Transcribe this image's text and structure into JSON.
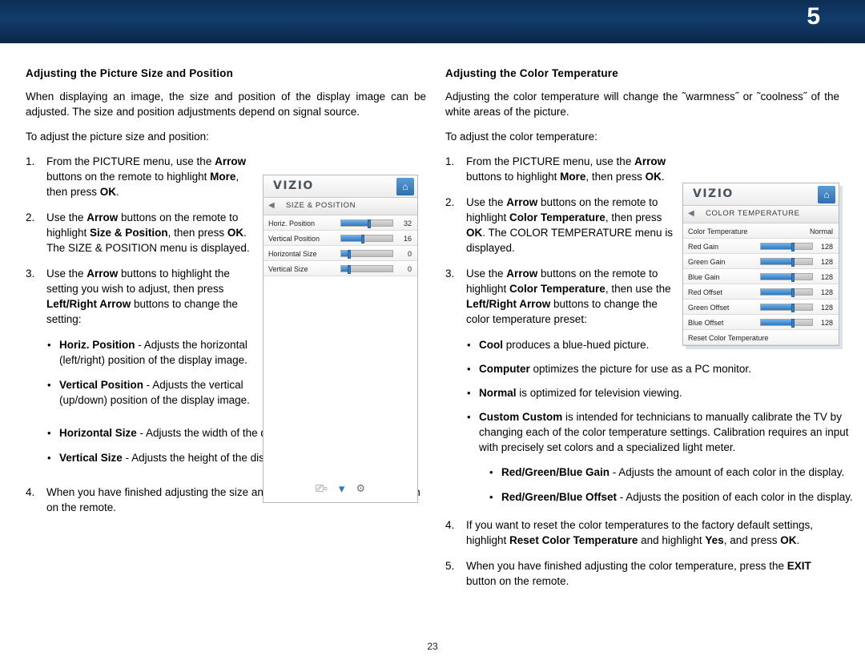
{
  "header": {
    "chapter_number": "5"
  },
  "page_number": "23",
  "left": {
    "title": "Adjusting the Picture Size and Position",
    "intro1": "When displaying an image, the size and position of the display image can be adjusted. The size and position adjustments depend on signal source.",
    "intro2": "To adjust the picture size and position:",
    "steps": [
      {
        "num": "1.",
        "html": "From the PICTURE menu, use the <b>Arrow</b> buttons on the remote to highlight <b>More</b>, then press <b>OK</b>."
      },
      {
        "num": "2.",
        "html": "Use the <b>Arrow</b> buttons on the remote to highlight <b>Size &amp; Position</b>, then press <b>OK</b>. The SIZE &amp; POSITION menu is displayed."
      },
      {
        "num": "3.",
        "html": "Use the <b>Arrow</b> buttons to highlight the setting you wish to adjust, then press <b>Left/Right Arrow</b> buttons to change the setting:"
      }
    ],
    "sub_bullets": [
      "<b>Horiz. Position</b> - Adjusts the horizontal (left/right) position of the display image.",
      "<b>Vertical Position</b> - Adjusts the vertical (up/down) position of the display image."
    ],
    "wide_bullets": [
      "<b>Horizontal Size</b> - Adjusts the width of the display image.",
      "<b>Vertical Size</b> - Adjusts the height of the display image."
    ],
    "step4": {
      "num": "4.",
      "html": "When you have finished adjusting the size and position, press the <b>EXIT</b> button on the remote."
    }
  },
  "right": {
    "title": "Adjusting the Color Temperature",
    "intro1": "Adjusting the color temperature will change the ˜warmness˝ or ˜coolness˝ of the white areas of the picture.",
    "intro2": "To adjust the color temperature:",
    "steps": [
      {
        "num": "1.",
        "html": "From the PICTURE menu, use the <b>Arrow</b> buttons to highlight <b>More</b>, then press <b>OK</b>."
      },
      {
        "num": "2.",
        "html": "Use the <b>Arrow</b> buttons on the remote to highlight <b>Color Temperature</b>, then press <b>OK</b>. The COLOR TEMPERATURE menu is displayed."
      },
      {
        "num": "3.",
        "html": "Use the <b>Arrow</b> buttons on the remote to highlight <b>Color Temperature</b>, then use the <b>Left/Right Arrow</b> buttons to change the color temperature preset:"
      }
    ],
    "preset_bullets": [
      "<b>Cool</b> produces a blue-hued picture.",
      "<b>Computer</b> optimizes the picture for use as a PC monitor.",
      "<b>Normal</b> is optimized for television viewing.",
      "<b>Custom Custom</b> is intended for technicians to manually calibrate the TV by changing each of the color temperature settings. Calibration requires an input with precisely set colors and a specialized light meter."
    ],
    "gain_bullets": [
      "<b>Red/Green/Blue Gain</b> - Adjusts the amount of each color in the display.",
      "<b>Red/Green/Blue Offset</b> - Adjusts the position of each color in the display."
    ],
    "step4": {
      "num": "4.",
      "html": "If you want to reset the color temperatures to the factory default settings, highlight <b>Reset Color Temperature</b> and highlight <b>Yes</b>, and press <b>OK</b>."
    },
    "step5": {
      "num": "5.",
      "html": "When you have finished adjusting the color temperature, press the <b>EXIT</b> button on the remote."
    }
  },
  "osd_size_position": {
    "brand": "VIZIO",
    "menu_title": "SIZE & POSITION",
    "rows": [
      {
        "label": "Horiz. Position",
        "value": "32",
        "fill_pct": 55
      },
      {
        "label": "Vertical Position",
        "value": "16",
        "fill_pct": 42
      },
      {
        "label": "Horizontal Size",
        "value": "0",
        "fill_pct": 16
      },
      {
        "label": "Vertical Size",
        "value": "0",
        "fill_pct": 16
      }
    ]
  },
  "osd_color_temperature": {
    "brand": "VIZIO",
    "menu_title": "COLOR TEMPERATURE",
    "rows": [
      {
        "label": "Color Temperature",
        "value": "Normal",
        "slider": false,
        "fill_pct": 0
      },
      {
        "label": "Red Gain",
        "value": "128",
        "slider": true,
        "fill_pct": 62
      },
      {
        "label": "Green Gain",
        "value": "128",
        "slider": true,
        "fill_pct": 62
      },
      {
        "label": "Blue Gain",
        "value": "128",
        "slider": true,
        "fill_pct": 62
      },
      {
        "label": "Red Offset",
        "value": "128",
        "slider": true,
        "fill_pct": 62
      },
      {
        "label": "Green Offset",
        "value": "128",
        "slider": true,
        "fill_pct": 62
      },
      {
        "label": "Blue Offset",
        "value": "128",
        "slider": true,
        "fill_pct": 62
      },
      {
        "label": "Reset Color Temperature",
        "value": "",
        "slider": false,
        "fill_pct": 0
      }
    ]
  },
  "colors": {
    "header_blue": "#123c6b",
    "accent_blue": "#2f78bd"
  }
}
